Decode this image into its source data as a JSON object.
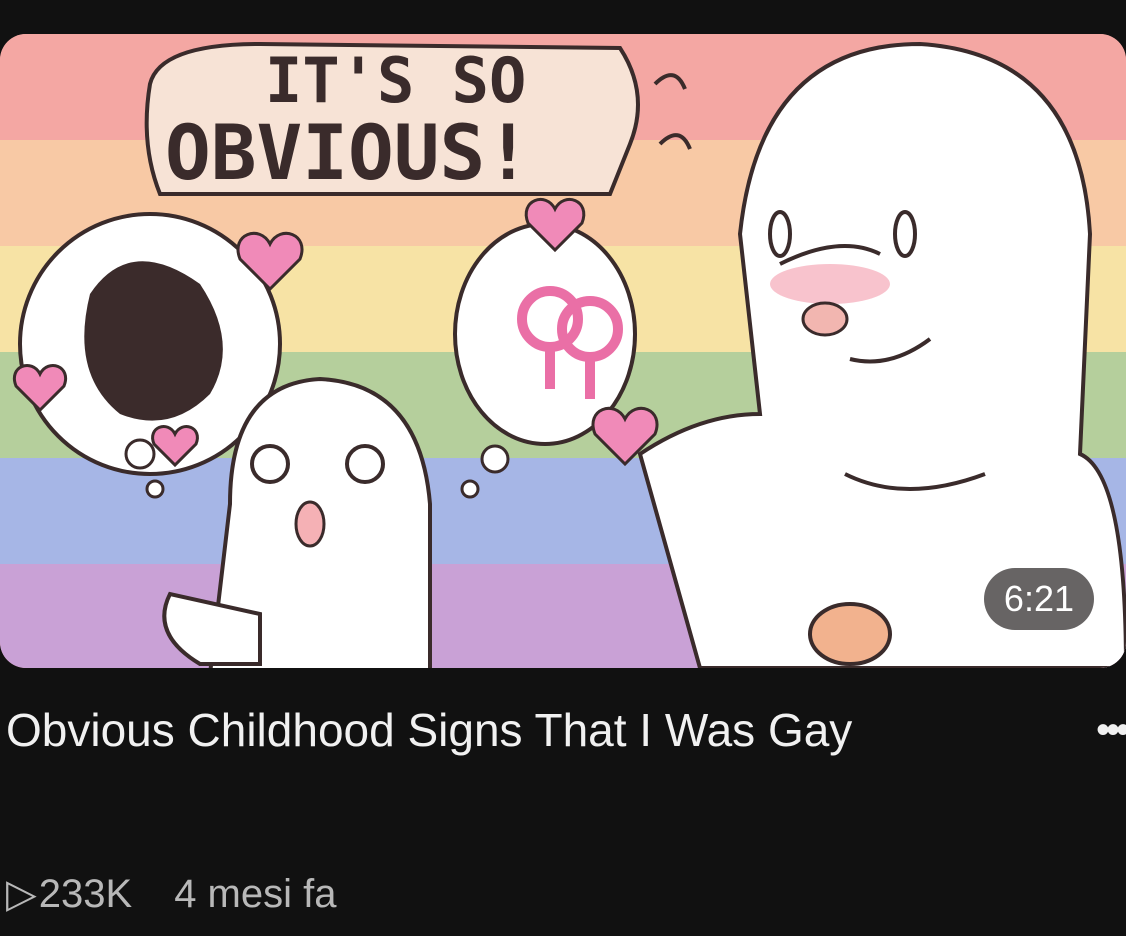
{
  "video": {
    "thumbnail_caption_line1": "IT'S SO",
    "thumbnail_caption_line2": "OBVIOUS!",
    "duration": "6:21",
    "title": "Obvious Childhood Signs That I Was Gay",
    "views": "233K",
    "age": "4 mesi fa",
    "play_icon": "play-outline-icon",
    "more_icon": "more-dots-icon",
    "more_label": "•••"
  },
  "colors": {
    "background": "#111111",
    "title_text": "#f1f1f1",
    "meta_text": "#b8b8b8",
    "flag_stripes": [
      "#f4a7a3",
      "#f8c9a5",
      "#f7e3a5",
      "#b5cf9c",
      "#a6b6e6",
      "#c9a1d6"
    ]
  }
}
